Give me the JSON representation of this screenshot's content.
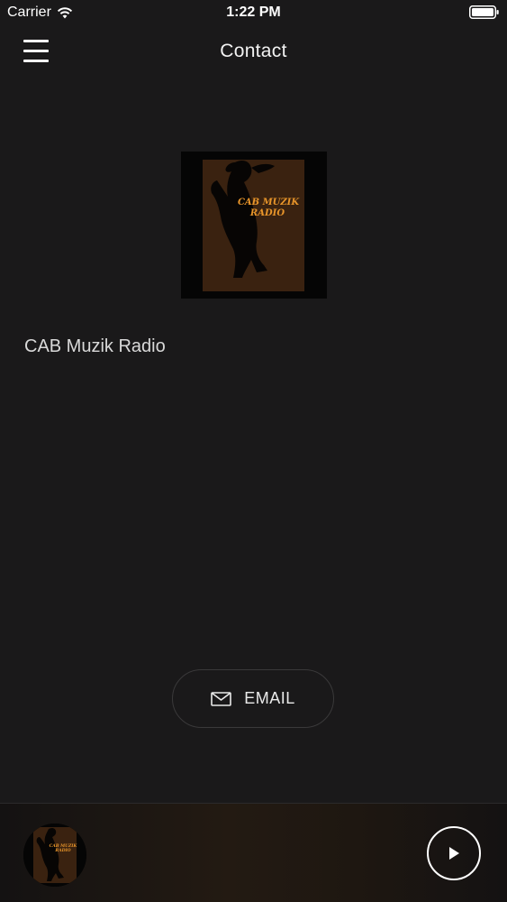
{
  "status_bar": {
    "carrier": "Carrier",
    "time": "1:22 PM",
    "wifi_icon": "wifi-icon",
    "battery_icon": "battery-icon"
  },
  "nav": {
    "title": "Contact",
    "menu_icon": "hamburger-menu-icon"
  },
  "station": {
    "logo_text_line1": "CAB MUZIK",
    "logo_text_line2": "RADIO",
    "name": "CAB Muzik Radio"
  },
  "contact": {
    "email_label": "EMAIL",
    "email_icon": "envelope-icon"
  },
  "player": {
    "play_icon": "play-icon"
  },
  "colors": {
    "background": "#1a191a",
    "logo_accent": "#e8952a",
    "logo_bg": "#3a2210"
  }
}
